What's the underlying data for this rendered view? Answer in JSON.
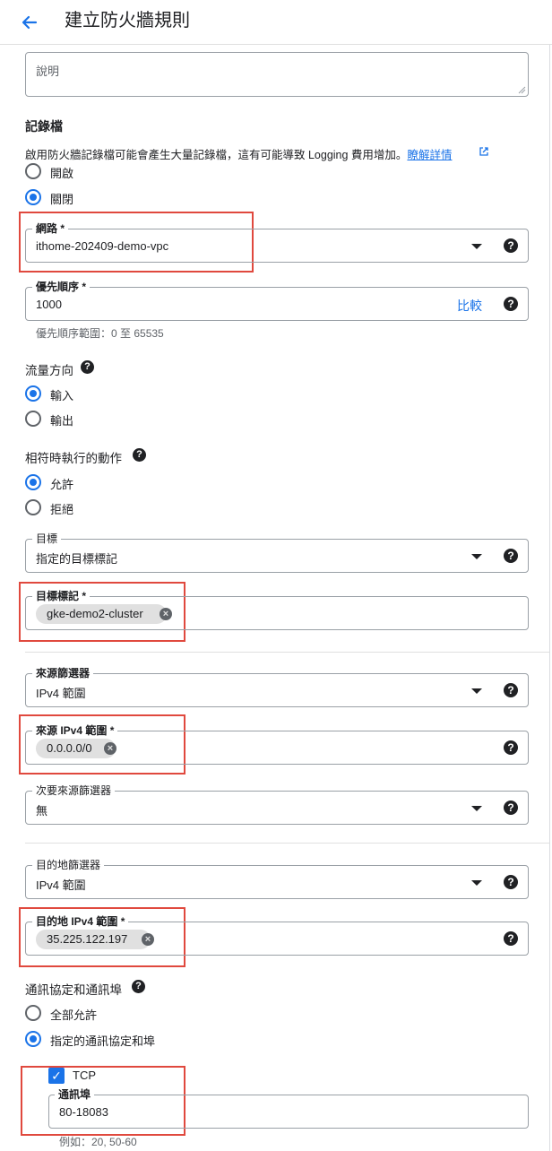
{
  "header": {
    "title": "建立防火牆規則"
  },
  "description": {
    "placeholder": "說明"
  },
  "logs": {
    "title": "記錄檔",
    "note": "啟用防火牆記錄檔可能會產生大量記錄檔，這有可能導致 Logging 費用增加。",
    "link": "瞭解詳情",
    "options": [
      "開啟",
      "關閉"
    ],
    "selected": "關閉"
  },
  "network": {
    "label": "網路 *",
    "value": "ithome-202409-demo-vpc"
  },
  "priority": {
    "label": "優先順序 *",
    "value": "1000",
    "compare": "比較",
    "hint": "優先順序範圍：0 至 65535"
  },
  "direction": {
    "title": "流量方向",
    "options": [
      "輸入",
      "輸出"
    ],
    "selected": "輸入"
  },
  "action": {
    "title": "相符時執行的動作",
    "options": [
      "允許",
      "拒絕"
    ],
    "selected": "允許"
  },
  "target": {
    "label": "目標",
    "value": "指定的目標標記"
  },
  "target_tags": {
    "label": "目標標記 *",
    "chip": "gke-demo2-cluster"
  },
  "source_filter": {
    "label": "來源篩選器",
    "value": "IPv4 範圍"
  },
  "source_ranges": {
    "label": "來源 IPv4 範圍 *",
    "chip": "0.0.0.0/0"
  },
  "secondary_source_filter": {
    "label": "次要來源篩選器",
    "value": "無"
  },
  "dest_filter": {
    "label": "目的地篩選器",
    "value": "IPv4 範圍"
  },
  "dest_ranges": {
    "label": "目的地 IPv4 範圍 *",
    "chip": "35.225.122.197"
  },
  "protocols": {
    "title": "通訊協定和通訊埠",
    "options": [
      "全部允許",
      "指定的通訊協定和埠"
    ],
    "selected": "指定的通訊協定和埠",
    "tcp_label": "TCP",
    "tcp_checked": true,
    "ports_label": "通訊埠",
    "ports_value": "80-18083",
    "ports_hint": "例如：20, 50-60"
  },
  "colors": {
    "accent": "#1a73e8",
    "highlight": "#e0493e"
  },
  "icons": {
    "back": "arrow-left-icon",
    "help": "help-icon",
    "external": "external-link-icon",
    "dropdown": "dropdown-caret-icon",
    "remove": "chip-remove-icon"
  }
}
